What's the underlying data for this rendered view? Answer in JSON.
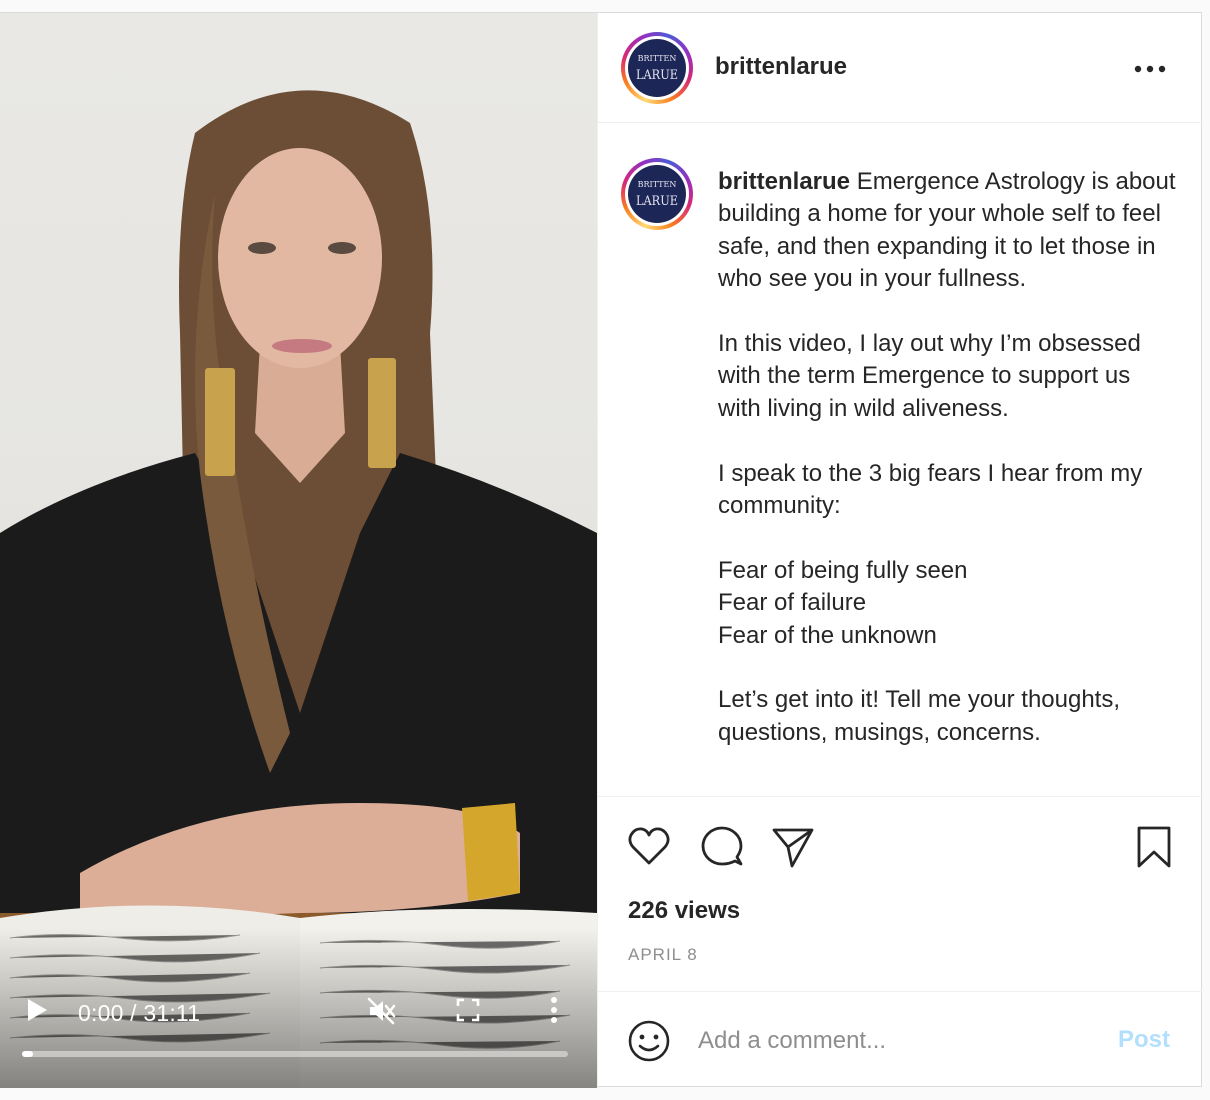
{
  "post": {
    "username": "brittenlarue",
    "avatar_text_top": "BRITTEN",
    "avatar_text_bottom": "LARUE"
  },
  "video": {
    "time_display": "0:00 / 31:11",
    "progress_fraction": 0.02,
    "notebook_text": "Handwritten journal pages"
  },
  "caption": {
    "username": "brittenlarue",
    "paragraphs": [
      "Emergence Astrology is about building a home for your whole self to feel safe, and then expanding it to let those in who see you in your fullness.",
      "In this video, I lay out why I’m obsessed with the term Emergence to support us with living in wild aliveness.",
      "I speak to the 3 big fears I hear from my community:",
      "Fear of being fully seen",
      "Fear of failure",
      "Fear of the unknown",
      "Let’s get into it! Tell me your thoughts, questions, musings, concerns."
    ]
  },
  "stats": {
    "views": "226 views",
    "date": "APRIL 8"
  },
  "comment": {
    "placeholder": "Add a comment...",
    "post_label": "Post"
  },
  "colors": {
    "post_button_disabled": "#b2dffc",
    "text": "#262626",
    "muted": "#8e8e8e",
    "avatar_bg": "#1d2757"
  },
  "icons": [
    "play-icon",
    "mute-icon",
    "fullscreen-icon",
    "more-vertical-icon",
    "more-horizontal-icon",
    "heart-icon",
    "comment-icon",
    "share-icon",
    "bookmark-icon",
    "emoji-icon"
  ]
}
